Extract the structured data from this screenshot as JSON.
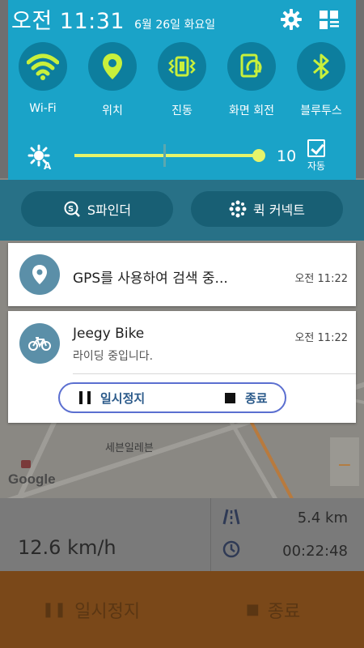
{
  "status_bar": {
    "clock": "오전 11:31",
    "date": "6월 26일 화요일"
  },
  "icons": {
    "settings": "gear-icon",
    "edit_tiles": "grid-edit-icon",
    "wifi": "wifi-icon",
    "location": "location-pin-icon",
    "vibrate": "vibrate-icon",
    "rotate": "screen-rotation-icon",
    "bluetooth": "bluetooth-icon",
    "brightness": "auto-brightness-sun-icon",
    "s_finder": "s-finder-icon",
    "quick_connect": "quick-connect-icon",
    "gps_app": "location-pin-icon",
    "bike_app": "bicycle-icon"
  },
  "quick_toggles": [
    {
      "label": "Wi-Fi"
    },
    {
      "label": "위치"
    },
    {
      "label": "진동"
    },
    {
      "label": "화면 회전"
    },
    {
      "label": "블루투스"
    }
  ],
  "brightness": {
    "level": "10",
    "fraction": 1.0,
    "auto_label": "자동",
    "auto_checked": true
  },
  "quick_buttons": {
    "s_finder": "S파인더",
    "quick_connect": "퀵 커넥트"
  },
  "notifications": {
    "gps": {
      "title": "GPS를 사용하여 검색 중...",
      "time": "오전 11:22"
    },
    "bike": {
      "title": "Jeegy Bike",
      "text": "라이딩 중입니다.",
      "time": "오전 11:22",
      "pause_label": "일시정지",
      "stop_label": "종료"
    }
  },
  "background_app": {
    "map_place": "세븐일레븐",
    "map_brand": "Google",
    "speed": "12.6 km/h",
    "distance": "5.4 km",
    "duration": "00:22:48",
    "pause_label": "일시정지",
    "stop_label": "종료"
  },
  "colors": {
    "shade": "#1aa3c8",
    "toggle_active": "#c8f03c",
    "app_accent": "#e07a1f"
  }
}
